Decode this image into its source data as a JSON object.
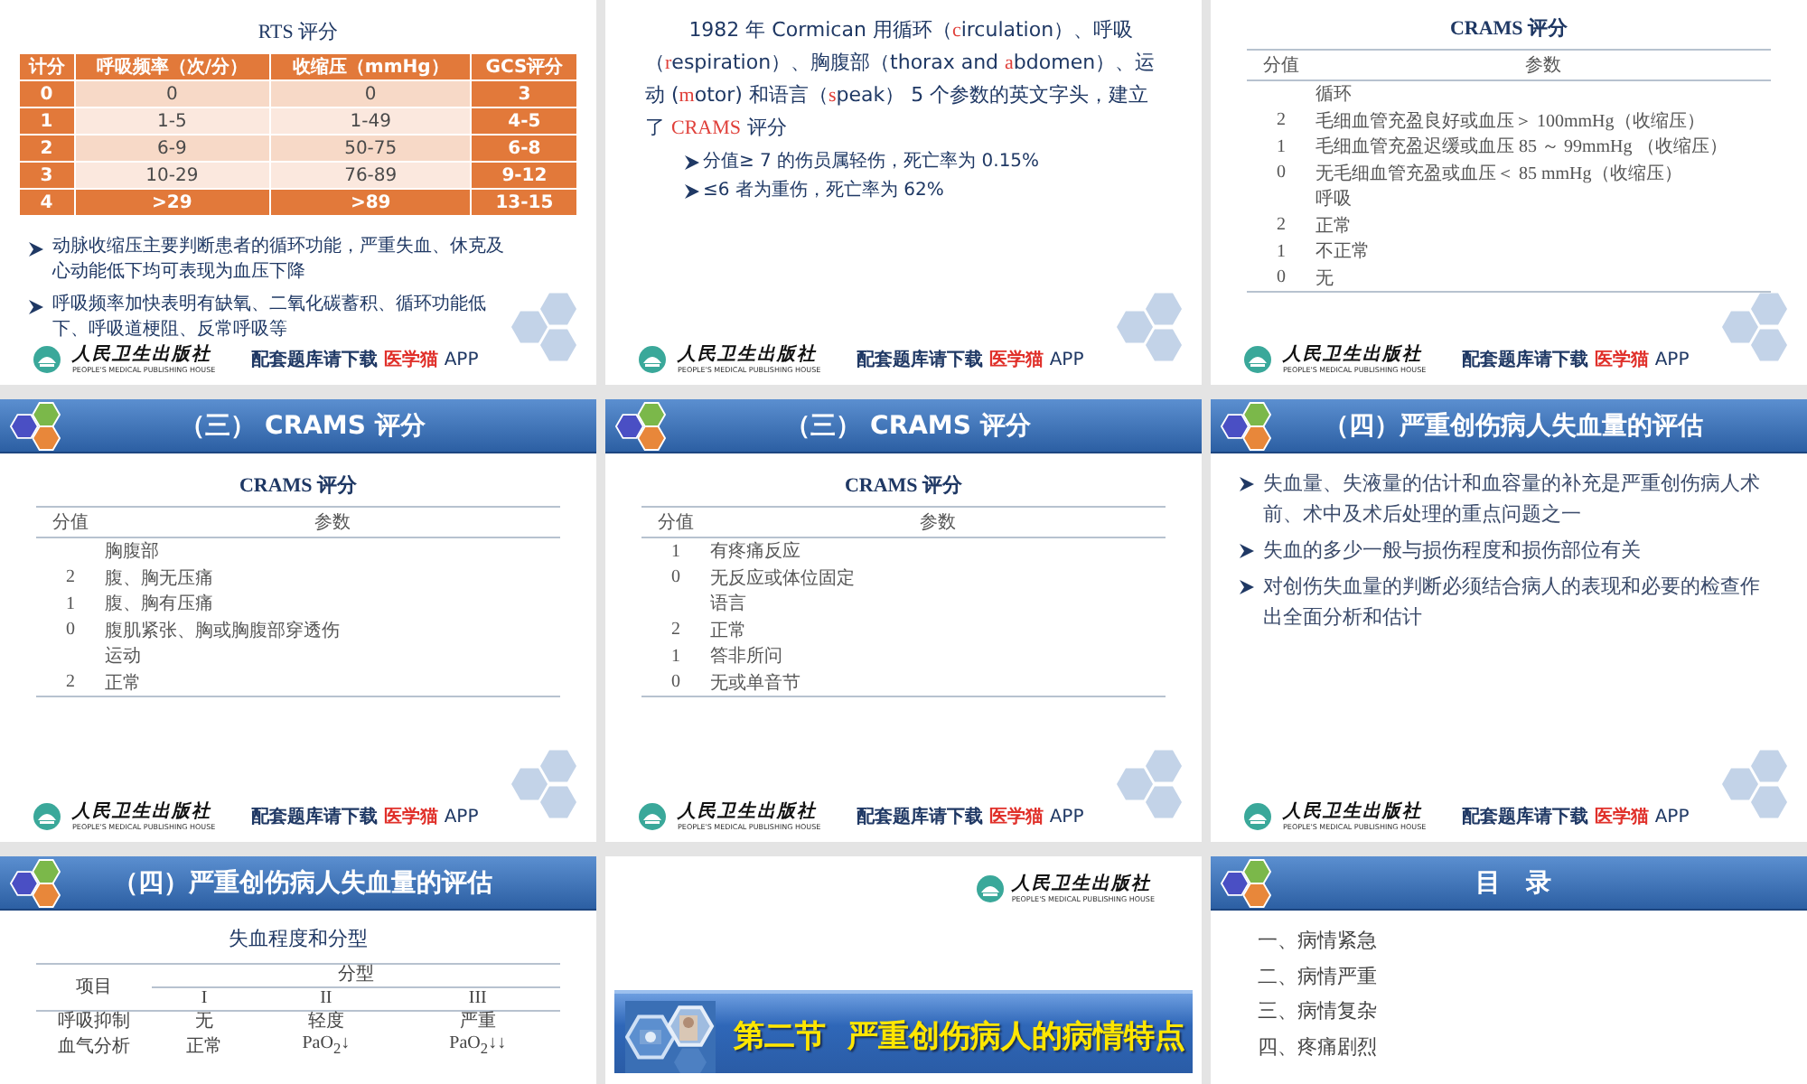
{
  "slides": [
    {
      "kind": "rts_table",
      "title": "RTS 评分",
      "table": {
        "columns": [
          "计分",
          "呼吸频率（次/分）",
          "收缩压（mmHg）",
          "GCS评分"
        ],
        "rows": [
          {
            "cells": [
              "0",
              "0",
              "0",
              "3"
            ],
            "highlighted": false
          },
          {
            "cells": [
              "1",
              "1-5",
              "1-49",
              "4-5"
            ],
            "highlighted": false
          },
          {
            "cells": [
              "2",
              "6-9",
              "50-75",
              "6-8"
            ],
            "highlighted": false
          },
          {
            "cells": [
              "3",
              "10-29",
              "76-89",
              "9-12"
            ],
            "highlighted": false
          },
          {
            "cells": [
              "4",
              ">29",
              ">89",
              "13-15"
            ],
            "highlighted": true
          }
        ]
      },
      "bullets": [
        "动脉收缩压主要判断患者的循环功能，严重失血、休克及心动能低下均可表现为血压下降",
        "呼吸频率加快表明有缺氧、二氧化碳蓄积、循环功能低下、呼吸道梗阻、反常呼吸等"
      ],
      "footer": {
        "publisher": "人民卫生出版社",
        "publisher_en": "PEOPLE'S MEDICAL PUBLISHING HOUSE",
        "note": "配套题库请下载",
        "app": "医学猫",
        "suffix": "APP"
      }
    },
    {
      "kind": "paragraph",
      "segments": [
        {
          "text": "1982 年 Cormican 用循环（",
          "highlight": false
        },
        {
          "text": "c",
          "highlight": true
        },
        {
          "text": "irculation）、呼吸（",
          "highlight": false
        },
        {
          "text": "r",
          "highlight": true
        },
        {
          "text": "espiration）、胸腹部（thorax and ",
          "highlight": false
        },
        {
          "text": "a",
          "highlight": true
        },
        {
          "text": "bdomen）、运动 (",
          "highlight": false
        },
        {
          "text": "m",
          "highlight": true
        },
        {
          "text": "otor) 和语言（",
          "highlight": false
        },
        {
          "text": "s",
          "highlight": true
        },
        {
          "text": "peak） 5 个参数的英文字头，建立了 ",
          "highlight": false
        },
        {
          "text": "CRAMS",
          "highlight": true
        },
        {
          "text": " 评分",
          "highlight": false
        }
      ],
      "bullets": [
        "分值≥ 7 的伤员属轻伤，死亡率为 0.15%",
        "≤6 者为重伤，死亡率为 62%"
      ],
      "footer": {
        "publisher": "人民卫生出版社",
        "publisher_en": "PEOPLE'S MEDICAL PUBLISHING HOUSE",
        "note": "配套题库请下载",
        "app": "医学猫",
        "suffix": "APP"
      }
    },
    {
      "kind": "crams_table",
      "title": "CRAMS 评分",
      "columns": [
        "分值",
        "参数"
      ],
      "rows": [
        {
          "param": "循环"
        },
        {
          "score": "2",
          "param": "毛细血管充盈良好或血压＞ 100mmHg（收缩压）"
        },
        {
          "score": "1",
          "param": "毛细血管充盈迟缓或血压 85 ～ 99mmHg （收缩压）"
        },
        {
          "score": "0",
          "param": "无毛细血管充盈或血压＜ 85 mmHg（收缩压）"
        },
        {
          "param": "呼吸"
        },
        {
          "score": "2",
          "param": "正常"
        },
        {
          "score": "1",
          "param": "不正常"
        },
        {
          "score": "0",
          "param": "无"
        }
      ],
      "footer": {
        "publisher": "人民卫生出版社",
        "publisher_en": "PEOPLE'S MEDICAL PUBLISHING HOUSE",
        "note": "配套题库请下载",
        "app": "医学猫",
        "suffix": "APP"
      }
    },
    {
      "kind": "crams_table",
      "header": "（三） CRAMS 评分",
      "title": "CRAMS 评分",
      "columns": [
        "分值",
        "参数"
      ],
      "rows": [
        {
          "param": "胸腹部"
        },
        {
          "score": "2",
          "param": "腹、胸无压痛"
        },
        {
          "score": "1",
          "param": "腹、胸有压痛"
        },
        {
          "score": "0",
          "param": "腹肌紧张、胸或胸腹部穿透伤"
        },
        {
          "param": "运动"
        },
        {
          "score": "2",
          "param": "正常"
        }
      ],
      "footer": {
        "publisher": "人民卫生出版社",
        "publisher_en": "PEOPLE'S MEDICAL PUBLISHING HOUSE",
        "note": "配套题库请下载",
        "app": "医学猫",
        "suffix": "APP"
      }
    },
    {
      "kind": "crams_table",
      "header": "（三） CRAMS 评分",
      "title": "CRAMS 评分",
      "columns": [
        "分值",
        "参数"
      ],
      "rows": [
        {
          "score": "1",
          "param": "有疼痛反应"
        },
        {
          "score": "0",
          "param": "无反应或体位固定"
        },
        {
          "param": "语言"
        },
        {
          "score": "2",
          "param": "正常"
        },
        {
          "score": "1",
          "param": "答非所问"
        },
        {
          "score": "0",
          "param": "无或单音节"
        }
      ],
      "footer": {
        "publisher": "人民卫生出版社",
        "publisher_en": "PEOPLE'S MEDICAL PUBLISHING HOUSE",
        "note": "配套题库请下载",
        "app": "医学猫",
        "suffix": "APP"
      }
    },
    {
      "kind": "bullets",
      "header": "（四）严重创伤病人失血量的评估",
      "bullets": [
        "失血量、失液量的估计和血容量的补充是严重创伤病人术前、术中及术后处理的重点问题之一",
        "失血的多少一般与损伤程度和损伤部位有关",
        "对创伤失血量的判断必须结合病人的表现和必要的检查作出全面分析和估计"
      ],
      "footer": {
        "publisher": "人民卫生出版社",
        "publisher_en": "PEOPLE'S MEDICAL PUBLISHING HOUSE",
        "note": "配套题库请下载",
        "app": "医学猫",
        "suffix": "APP"
      }
    },
    {
      "kind": "grade_table",
      "header": "（四）严重创伤病人失血量的评估",
      "title": "失血程度和分型",
      "row_header": "项目",
      "group": "分型",
      "grades": [
        "I",
        "II",
        "III"
      ],
      "rows": [
        {
          "label": "呼吸抑制",
          "cells": [
            "无",
            "轻度",
            "严重"
          ]
        },
        {
          "label": "血气分析",
          "cells": [
            "正常",
            "PaO$_{2}$↓",
            "PaO$_{2}$↓↓"
          ]
        }
      ]
    },
    {
      "kind": "section",
      "publisher": "人民卫生出版社",
      "publisher_en": "PEOPLE'S MEDICAL PUBLISHING HOUSE",
      "title": "第二节  严重创伤病人的病情特点"
    },
    {
      "kind": "contents",
      "header": "目　录",
      "items": [
        "一、病情紧急",
        "二、病情严重",
        "三、病情复杂",
        "四、疼痛剧烈"
      ]
    }
  ]
}
